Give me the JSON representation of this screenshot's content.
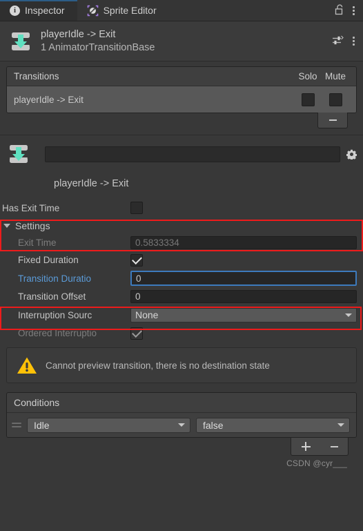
{
  "window": {
    "tabs": [
      {
        "label": "Inspector",
        "icon": "info-circle-icon",
        "active": true
      },
      {
        "label": "Sprite Editor",
        "icon": "sprite-editor-icon",
        "active": false
      }
    ],
    "lock_icon": "unlocked-padlock-icon",
    "menu_icon": "kebab-menu-icon"
  },
  "object_header": {
    "icon": "animator-transition-icon",
    "title": "playerIdle -> Exit",
    "subtitle": "1 AnimatorTransitionBase",
    "preset_icon": "preset-sliders-icon",
    "menu_icon": "kebab-menu-icon"
  },
  "transitions_panel": {
    "header": "Transitions",
    "solo_header": "Solo",
    "mute_header": "Mute",
    "rows": [
      {
        "label": "playerIdle -> Exit",
        "solo": false,
        "mute": false
      }
    ],
    "remove_button": "−"
  },
  "transition_detail": {
    "icon": "animator-transition-icon",
    "name_value": "",
    "settings_icon": "gear-icon",
    "transition_name": "playerIdle -> Exit"
  },
  "properties": {
    "has_exit_time": {
      "label": "Has Exit Time",
      "checked": false
    },
    "settings_foldout": "Settings",
    "exit_time": {
      "label": "Exit Time",
      "value": "0.5833334",
      "disabled": true
    },
    "fixed_duration": {
      "label": "Fixed Duration",
      "checked": true
    },
    "transition_duration": {
      "label": "Transition Duratio",
      "value": "0",
      "focused": true
    },
    "transition_offset": {
      "label": "Transition Offset",
      "value": "0"
    },
    "interruption_source": {
      "label": "Interruption Sourc",
      "value": "None"
    },
    "ordered_interruption": {
      "label": "Ordered Interruptio",
      "checked": true,
      "disabled": true
    }
  },
  "warning": {
    "icon": "warning-triangle-icon",
    "text": "Cannot preview transition, there is no destination state"
  },
  "conditions": {
    "header": "Conditions",
    "rows": [
      {
        "handle": "drag-handle-icon",
        "parameter": "Idle",
        "value": "false"
      }
    ],
    "add_button": "+",
    "remove_button": "−"
  },
  "watermark": "CSDN @cyr___",
  "colors": {
    "accent_blue": "#5b9bd8",
    "focus_border": "#3d7bbd",
    "annotation_red": "#ee1b1b",
    "transition_arrow": "#5fe0c0",
    "warning_yellow": "#ffc107",
    "tab_accent": "#2c5d87"
  }
}
